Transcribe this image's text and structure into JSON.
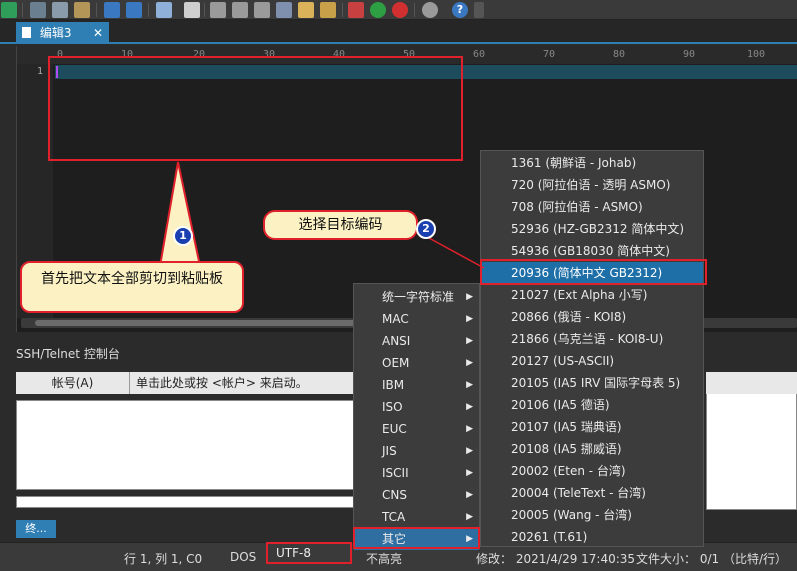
{
  "toolbar": {
    "icons": [
      "run-icon",
      "cut-icon",
      "copy-icon",
      "paste-icon",
      "undo-icon",
      "redo-icon",
      "column-icon",
      "find-icon",
      "find-next-icon",
      "replace-icon",
      "find-in-files-icon",
      "folder-icon",
      "macro-icon",
      "add-icon",
      "remove-icon",
      "settings-icon",
      "help-icon"
    ]
  },
  "tab": {
    "label": "编辑3",
    "close": "✕"
  },
  "ruler": {
    "marks": [
      "0",
      "10",
      "20",
      "30",
      "40",
      "50",
      "60",
      "70",
      "80",
      "90",
      "100"
    ]
  },
  "editor": {
    "line_number": "1"
  },
  "console": {
    "title": "SSH/Telnet 控制台",
    "account_label": "帐号(A)",
    "hint": "单击此处或按 <帐户> 来启动。",
    "terminal_button": "终..."
  },
  "statusbar": {
    "position": "行 1, 列 1, C0",
    "line_ending": "DOS",
    "encoding": "UTF-8",
    "mode": "不高亮",
    "modified": "修改：  2021/4/29 17:40:35",
    "file_size": "文件大小：  0/1  （比特/行）"
  },
  "annotations": {
    "bubble1": "首先把文本全部剪切到粘贴板",
    "bubble2": "选择目标编码",
    "badge1": "1",
    "badge2": "2"
  },
  "menu_left": {
    "items": [
      "统一字符标准",
      "MAC",
      "ANSI",
      "OEM",
      "IBM",
      "ISO",
      "EUC",
      "JIS",
      "ISCII",
      "CNS",
      "TCA",
      "其它"
    ],
    "active_index": 11
  },
  "menu_right": {
    "items": [
      "1361  (朝鲜语 - Johab)",
      "720  (阿拉伯语 - 透明 ASMO)",
      "708  (阿拉伯语 - ASMO)",
      "52936 (HZ-GB2312 简体中文)",
      "54936 (GB18030 简体中文)",
      "20936 (简体中文 GB2312)",
      "21027 (Ext Alpha 小写)",
      "20866 (俄语 - KOI8)",
      "21866 (乌克兰语 - KOI8-U)",
      "20127 (US-ASCII)",
      "20105 (IA5 IRV 国际字母表 5)",
      "20106 (IA5 德语)",
      "20107 (IA5 瑞典语)",
      "20108 (IA5 挪威语)",
      "20002 (Eten - 台湾)",
      "20004 (TeleText - 台湾)",
      "20005 (Wang - 台湾)",
      "20261 (T.61)"
    ],
    "active_index": 5
  },
  "colors": {
    "accent": "#2f7fb5",
    "highlight_red": "#e0202a",
    "bubble_fill": "#fbf1c3",
    "badge_blue": "#1a3fb0"
  }
}
